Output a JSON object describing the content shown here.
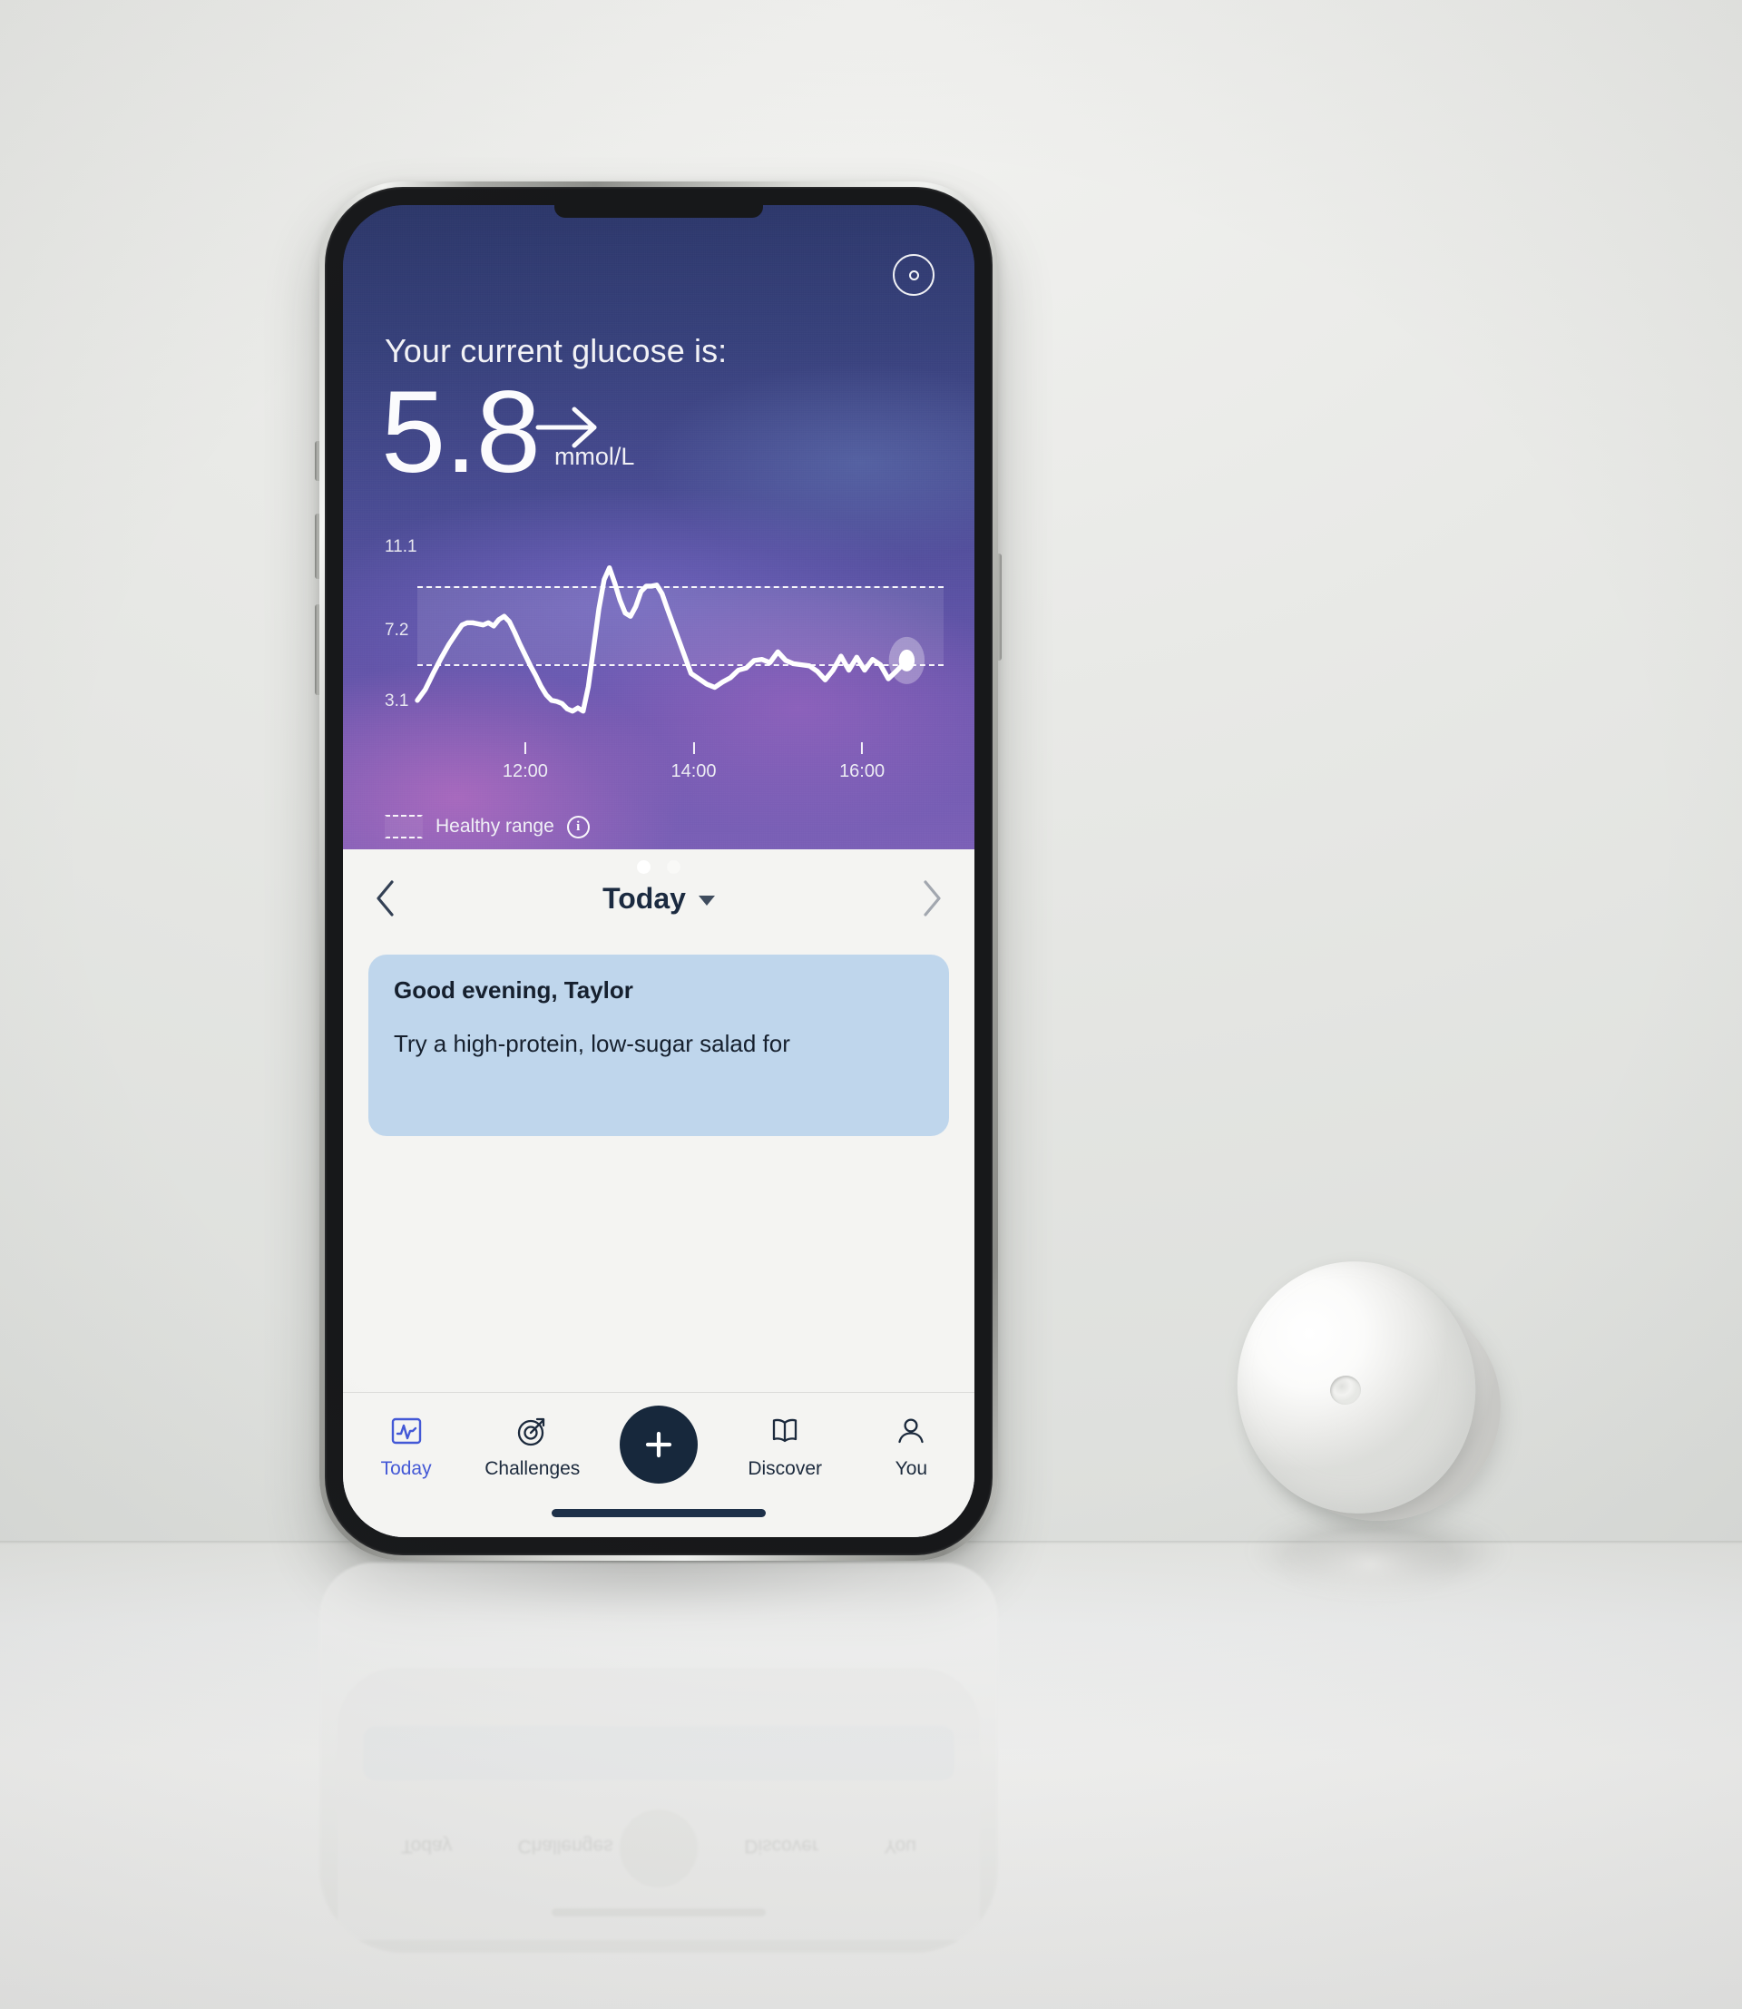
{
  "app": {
    "hero": {
      "sensor_icon": "sensor-scan-icon",
      "label": "Your current glucose is:",
      "value": "5.8",
      "trend_icon": "arrow-right-icon",
      "unit": "mmol/L"
    },
    "legend": {
      "swatch_icon": "dashed-band-icon",
      "label": "Healthy range",
      "info_icon": "info-icon"
    },
    "pager": {
      "total": 2,
      "active": 1
    },
    "day_nav": {
      "prev_icon": "chevron-left-icon",
      "next_icon": "chevron-right-icon",
      "title": "Today",
      "caret_icon": "caret-down-icon"
    },
    "tip_card": {
      "title": "Good evening, Taylor",
      "body": "Try a high-protein, low-sugar salad for"
    },
    "tabbar": {
      "items": [
        {
          "label": "Today",
          "icon": "glucose-graph-icon",
          "active": true
        },
        {
          "label": "Challenges",
          "icon": "target-arrow-icon",
          "active": false
        },
        {
          "label": "",
          "icon": "plus-icon",
          "active": false
        },
        {
          "label": "Discover",
          "icon": "open-book-icon",
          "active": false
        },
        {
          "label": "You",
          "icon": "person-icon",
          "active": false
        }
      ]
    },
    "colors": {
      "accent": "#4358d6",
      "dark": "#17283c",
      "tip_card_bg": "#bfd6ec",
      "sheet_bg": "#f4f4f2"
    }
  },
  "chart_data": {
    "type": "line",
    "title": "Glucose trace",
    "xlabel": "",
    "ylabel": "mmol/L",
    "ylim": [
      3.1,
      11.1
    ],
    "yticks": [
      "11.1",
      "7.2",
      "3.1"
    ],
    "ytick_values": [
      11.1,
      7.2,
      3.1
    ],
    "xticks": [
      "12:00",
      "14:00",
      "16:00"
    ],
    "xtick_positions": [
      0.205,
      0.525,
      0.845
    ],
    "grid": false,
    "legend": "Healthy range",
    "healthy_range": [
      3.9,
      7.8
    ],
    "current_point": {
      "x": 0.93,
      "y": 5.8,
      "label": "5.8"
    },
    "series": [
      {
        "name": "Glucose (mmol/L)",
        "x": [
          0.0,
          0.015,
          0.03,
          0.045,
          0.06,
          0.075,
          0.085,
          0.095,
          0.105,
          0.115,
          0.125,
          0.135,
          0.145,
          0.155,
          0.165,
          0.175,
          0.185,
          0.195,
          0.205,
          0.215,
          0.225,
          0.235,
          0.245,
          0.255,
          0.265,
          0.275,
          0.285,
          0.295,
          0.305,
          0.315,
          0.325,
          0.335,
          0.345,
          0.355,
          0.365,
          0.375,
          0.385,
          0.395,
          0.405,
          0.415,
          0.425,
          0.435,
          0.445,
          0.455,
          0.465,
          0.475,
          0.49,
          0.505,
          0.52,
          0.535,
          0.55,
          0.565,
          0.58,
          0.595,
          0.61,
          0.625,
          0.64,
          0.655,
          0.67,
          0.685,
          0.7,
          0.715,
          0.73,
          0.745,
          0.76,
          0.775,
          0.79,
          0.805,
          0.82,
          0.835,
          0.85,
          0.865,
          0.88,
          0.895,
          0.91,
          0.93
        ],
        "y": [
          3.95,
          4.45,
          5.2,
          5.9,
          6.55,
          7.1,
          7.45,
          7.55,
          7.55,
          7.5,
          7.45,
          7.55,
          7.4,
          7.7,
          7.85,
          7.6,
          7.1,
          6.55,
          6.05,
          5.55,
          5.1,
          4.6,
          4.2,
          3.95,
          3.9,
          3.8,
          3.55,
          3.45,
          3.6,
          3.45,
          4.6,
          6.4,
          8.2,
          9.55,
          10.1,
          9.4,
          8.6,
          8.0,
          7.85,
          8.3,
          9.0,
          9.25,
          9.25,
          9.3,
          8.9,
          8.2,
          7.2,
          6.2,
          5.2,
          4.95,
          4.7,
          4.55,
          4.8,
          5.0,
          5.35,
          5.45,
          5.8,
          5.85,
          5.7,
          6.2,
          5.8,
          5.65,
          5.6,
          5.55,
          5.3,
          4.9,
          5.35,
          6.0,
          5.35,
          5.95,
          5.35,
          5.85,
          5.6,
          4.95,
          5.3,
          5.8
        ]
      }
    ]
  }
}
